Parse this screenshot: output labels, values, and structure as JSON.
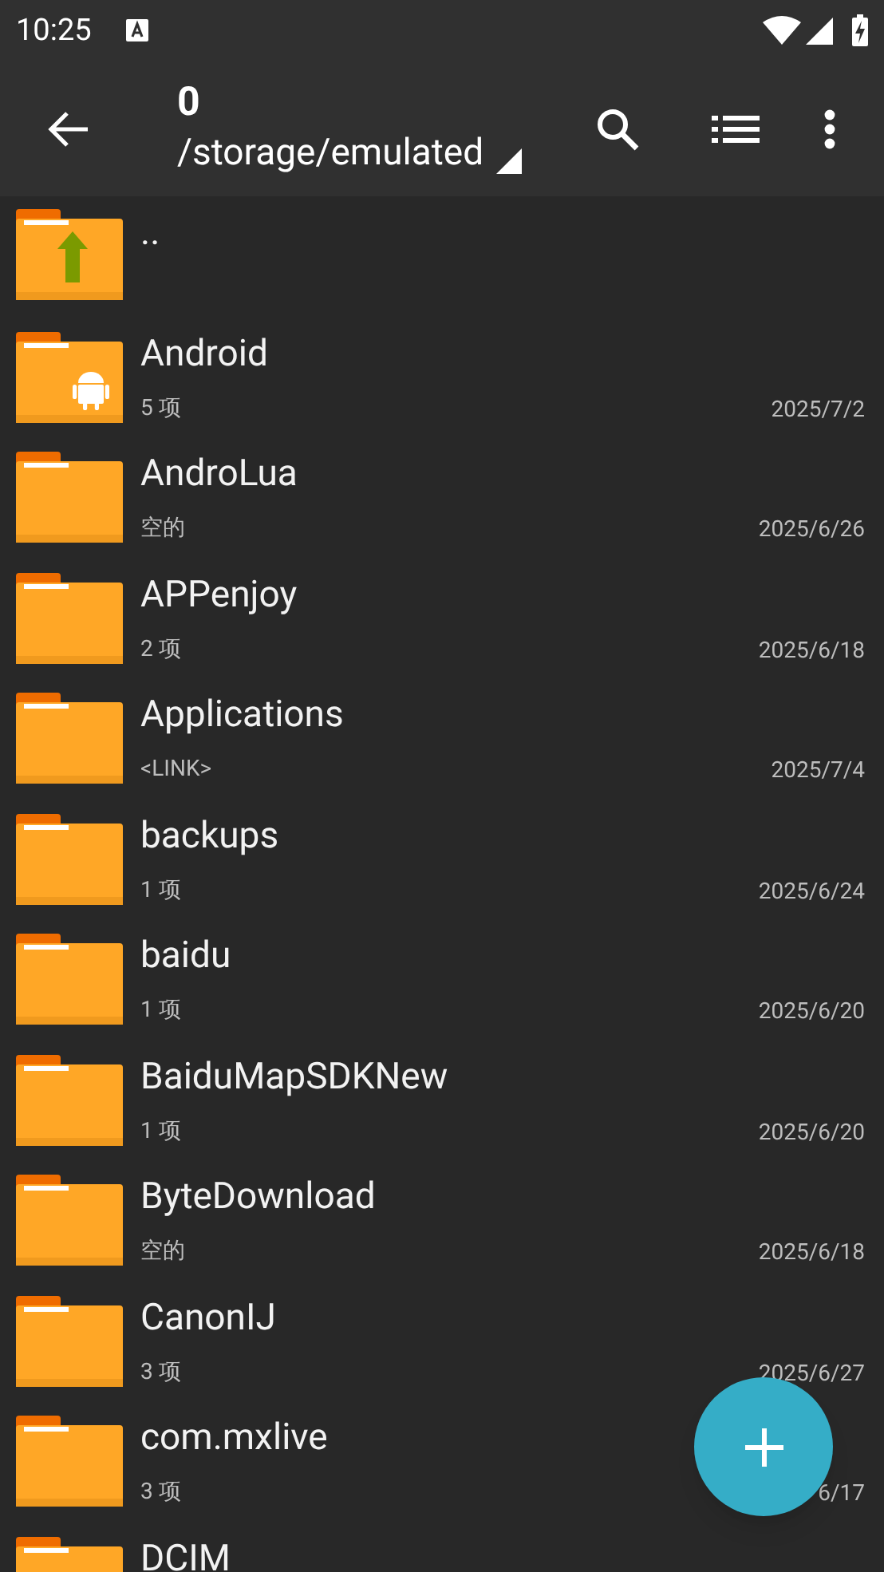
{
  "status_bar": {
    "time": "10:25"
  },
  "toolbar": {
    "title": "0",
    "path": "/storage/emulated"
  },
  "items": [
    {
      "kind": "parent",
      "name": ".."
    },
    {
      "kind": "android",
      "name": "Android",
      "info": "5 项",
      "date": "2025/7/2"
    },
    {
      "kind": "folder",
      "name": "AndroLua",
      "info": "空的",
      "date": "2025/6/26"
    },
    {
      "kind": "folder",
      "name": "APPenjoy",
      "info": "2 项",
      "date": "2025/6/18"
    },
    {
      "kind": "folder",
      "name": "Applications",
      "info": "<LINK>",
      "date": "2025/7/4"
    },
    {
      "kind": "folder",
      "name": "backups",
      "info": "1 项",
      "date": "2025/6/24"
    },
    {
      "kind": "folder",
      "name": "baidu",
      "info": "1 项",
      "date": "2025/6/20"
    },
    {
      "kind": "folder",
      "name": "BaiduMapSDKNew",
      "info": "1 项",
      "date": "2025/6/20"
    },
    {
      "kind": "folder",
      "name": "ByteDownload",
      "info": "空的",
      "date": "2025/6/18"
    },
    {
      "kind": "folder",
      "name": "CanonIJ",
      "info": "3 项",
      "date": "2025/6/27"
    },
    {
      "kind": "folder",
      "name": "com.mxlive",
      "info": "3 项",
      "date": "6/17"
    },
    {
      "kind": "folder",
      "name": "DCIM"
    }
  ]
}
